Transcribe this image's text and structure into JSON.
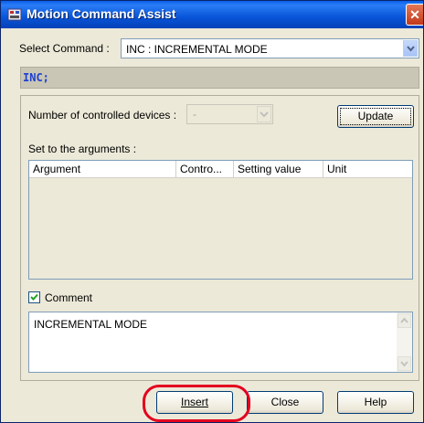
{
  "window": {
    "title": "Motion Command Assist",
    "close_glyph": "✕"
  },
  "select_command": {
    "label": "Select Command :",
    "value": "INC : INCREMENTAL MODE"
  },
  "code_preview": "INC;",
  "devices": {
    "label": "Number of controlled devices :",
    "value": "-",
    "update_button": "Update"
  },
  "arguments": {
    "label": "Set to the arguments :",
    "columns": [
      "Argument",
      "Contro...",
      "Setting value",
      "Unit"
    ],
    "rows": []
  },
  "comment": {
    "label": "Comment",
    "checked": true,
    "text": "INCREMENTAL MODE"
  },
  "buttons": {
    "insert": "Insert",
    "close": "Close",
    "help": "Help"
  },
  "colors": {
    "title_bar": "#0a5ee8",
    "highlight": "#e4001e",
    "code_text": "#1e40d0"
  }
}
